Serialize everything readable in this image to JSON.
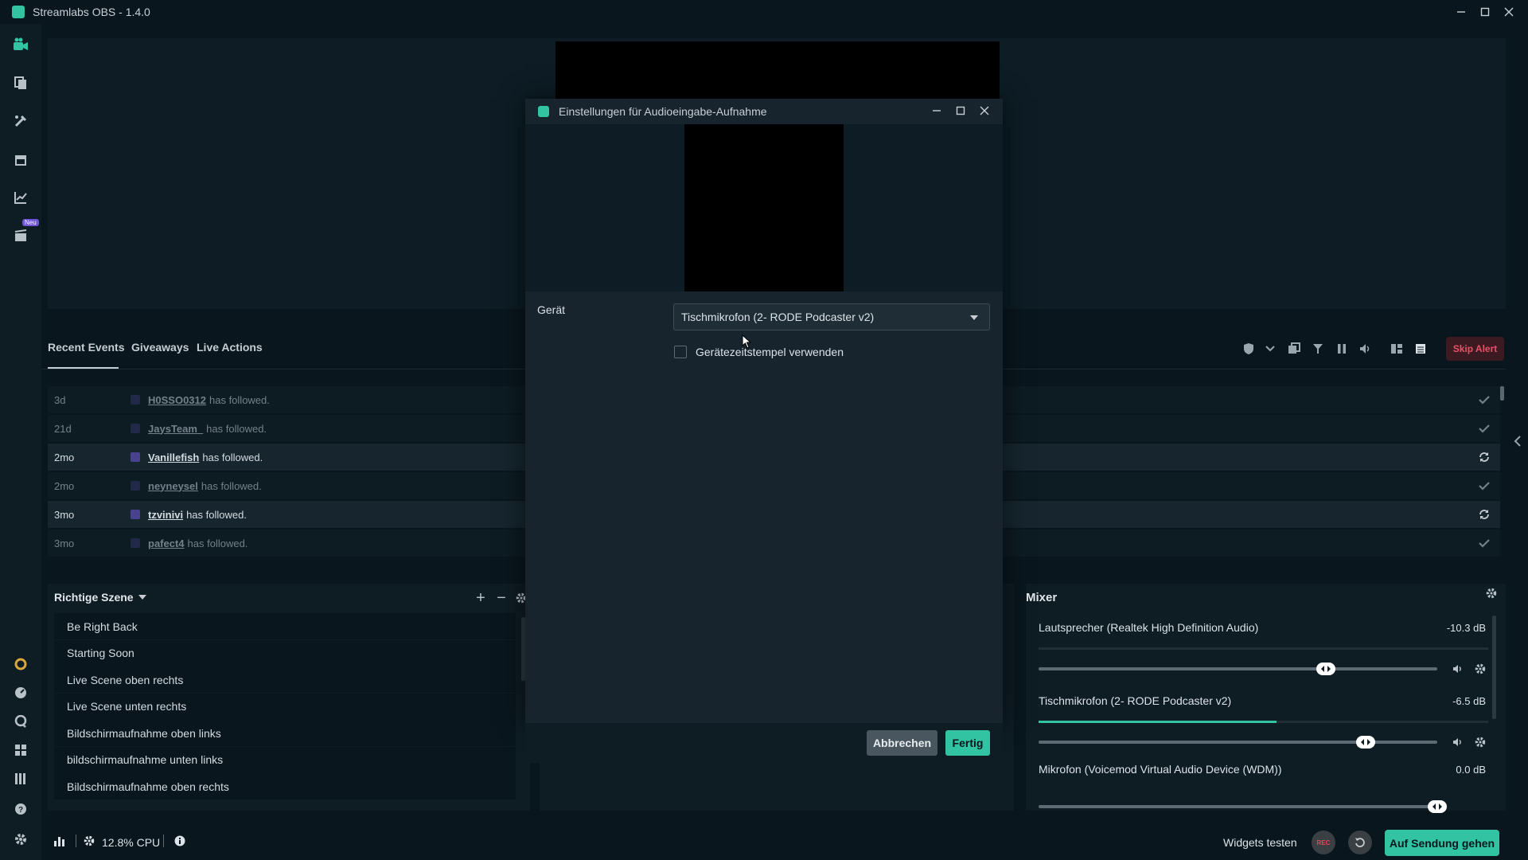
{
  "window": {
    "title": "Streamlabs OBS - 1.4.0"
  },
  "nav": {
    "new_badge": "Neu"
  },
  "events": {
    "tabs": [
      "Recent Events",
      "Giveaways",
      "Live Actions"
    ],
    "skip_alert": "Skip Alert",
    "rows": [
      {
        "time": "3d",
        "user": "H0SSO0312",
        "action": "has followed.",
        "status": "check",
        "highlighted": false
      },
      {
        "time": "21d",
        "user": "JaysTeam_",
        "action": "has followed.",
        "status": "check",
        "highlighted": false
      },
      {
        "time": "2mo",
        "user": "Vanillefish",
        "action": "has followed.",
        "status": "repeat",
        "highlighted": true
      },
      {
        "time": "2mo",
        "user": "neyneysel",
        "action": "has followed.",
        "status": "check",
        "highlighted": false
      },
      {
        "time": "3mo",
        "user": "tzvinivi",
        "action": "has followed.",
        "status": "repeat",
        "highlighted": true
      },
      {
        "time": "3mo",
        "user": "pafect4",
        "action": "has followed.",
        "status": "check",
        "highlighted": false
      }
    ]
  },
  "scenes": {
    "title": "Richtige Szene",
    "items": [
      "Be Right Back",
      "Starting Soon",
      "Live Scene oben rechts",
      "Live Scene unten rechts",
      "Bildschirmaufnahme oben links",
      "bildschirmaufnahme unten links",
      "Bildschirmaufnahme oben rechts"
    ]
  },
  "mixer": {
    "title": "Mixer",
    "channels": [
      {
        "name": "Lautsprecher (Realtek High Definition Audio)",
        "db": "-10.3 dB",
        "level": 0.72
      },
      {
        "name": "Tischmikrofon (2- RODE Podcaster v2)",
        "db": "-6.5 dB",
        "level": 0.82
      },
      {
        "name": "Mikrofon (Voicemod Virtual Audio Device (WDM))",
        "db": "0.0 dB",
        "level": 1.0
      }
    ]
  },
  "footer": {
    "cpu": "12.8% CPU",
    "widgets_test": "Widgets testen",
    "rec": "REC",
    "go_live": "Auf Sendung gehen"
  },
  "dialog": {
    "title": "Einstellungen für Audioeingabe-Aufnahme",
    "device_label": "Gerät",
    "device_value": "Tischmikrofon (2- RODE Podcaster v2)",
    "timestamp_label": "Gerätezeitstempel verwenden",
    "timestamp_checked": false,
    "cancel": "Abbrechen",
    "done": "Fertig"
  },
  "colors": {
    "accent": "#31c3a2",
    "background": "#09161d",
    "panel": "#0e1c24",
    "skip_alert": "#e55466"
  }
}
